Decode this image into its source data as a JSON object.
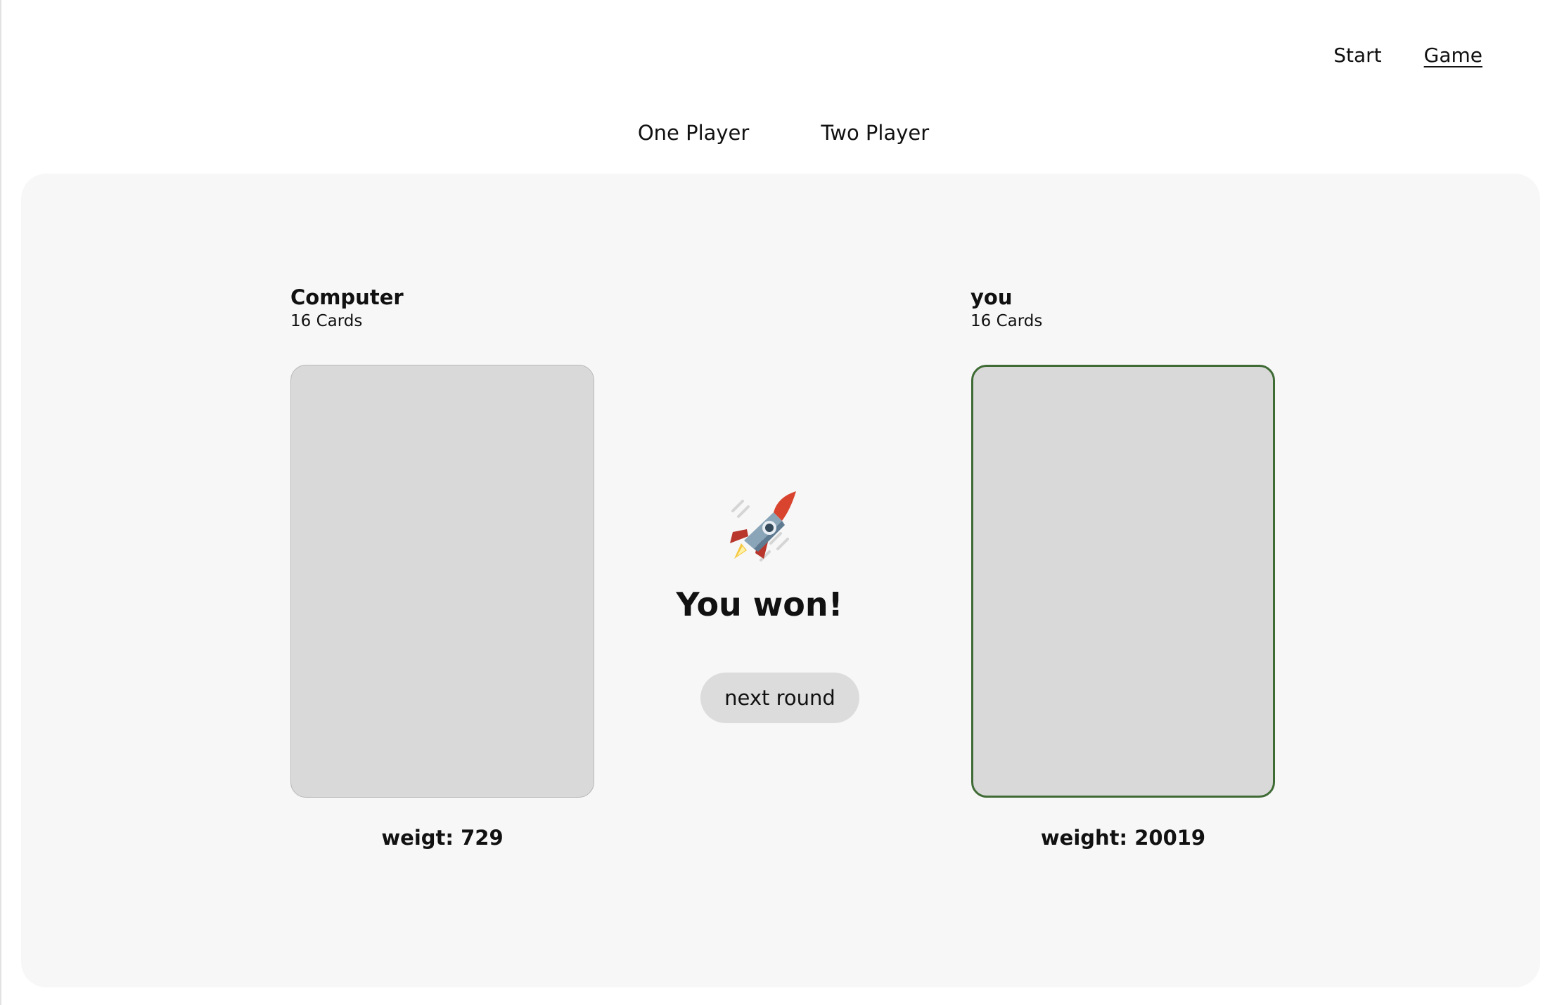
{
  "nav": {
    "items": [
      {
        "label": "Start",
        "active": false
      },
      {
        "label": "Game",
        "active": true
      }
    ]
  },
  "modes": {
    "one_player": "One Player",
    "two_player": "Two Player"
  },
  "players": {
    "left": {
      "name": "Computer",
      "cards": "16 Cards",
      "weight": "weigt: 729"
    },
    "right": {
      "name": "you",
      "cards": "16 Cards",
      "weight": "weight: 20019"
    }
  },
  "result": {
    "icon": "rocket-icon",
    "text": "You won!"
  },
  "actions": {
    "next_round": "next round"
  },
  "colors": {
    "board_bg": "#f7f7f7",
    "card_bg": "#d9d9d9",
    "winner_border": "#3f6b35",
    "button_bg": "#dcdcdc"
  }
}
